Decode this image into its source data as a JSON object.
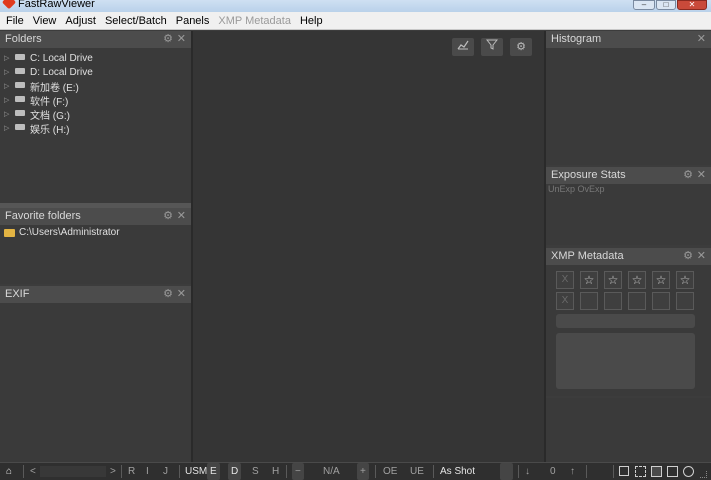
{
  "window": {
    "title": "FastRawViewer",
    "minimize": "–",
    "maximize": "□",
    "close": "✕"
  },
  "menu": [
    "File",
    "View",
    "Adjust",
    "Select/Batch",
    "Panels",
    "XMP Metadata",
    "Help"
  ],
  "folders": {
    "header": "Folders",
    "drives": [
      "C: Local Drive",
      "D: Local Drive",
      "新加卷 (E:)",
      "软件 (F:)",
      "文档 (G:)",
      "娱乐 (H:)"
    ]
  },
  "favorites": {
    "header": "Favorite folders",
    "items": [
      "C:\\Users\\Administrator"
    ]
  },
  "exif": {
    "header": "EXIF"
  },
  "histogram": {
    "header": "Histogram"
  },
  "exposure": {
    "header": "Exposure Stats",
    "cols": [
      "UnExp",
      "OvExp"
    ]
  },
  "xmp": {
    "header": "XMP Metadata",
    "reject": "X",
    "star": "☆"
  },
  "statusbar": {
    "folder_icon": "⌂",
    "prev": "<",
    "next": ">",
    "r": "R",
    "i": "I",
    "j": "J",
    "usm": "USM",
    "e": "E",
    "d": "D",
    "s": "S",
    "h": "H",
    "minus": "−",
    "na": "N/A",
    "plus": "+",
    "oe": "OE",
    "ue": "UE",
    "wb": "As Shot",
    "down": "↓",
    "zero": "0",
    "up": "↑"
  },
  "icons": {
    "histogram_tool": "chart-icon",
    "filter_tool": "filter-icon",
    "settings_tool": "gear-icon"
  }
}
